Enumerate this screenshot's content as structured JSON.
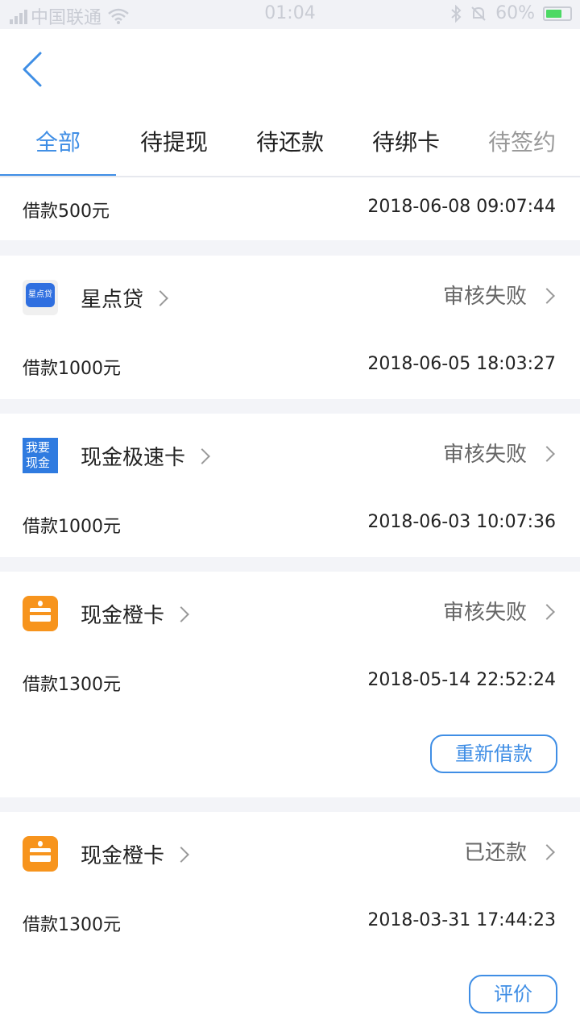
{
  "status_bar": {
    "carrier": "中国联通",
    "time": "01:04",
    "battery": "60%"
  },
  "tabs": [
    {
      "label": "全部",
      "active": true
    },
    {
      "label": "待提现",
      "active": false
    },
    {
      "label": "待还款",
      "active": false
    },
    {
      "label": "待绑卡",
      "active": false
    },
    {
      "label": "待签约",
      "active": false
    }
  ],
  "top_row": {
    "amount": "借款500元",
    "time": "2018-06-08 09:07:44"
  },
  "records": [
    {
      "lender": "星点贷",
      "logo_text": "星点贷",
      "status": "审核失败",
      "amount": "借款1000元",
      "time": "2018-06-05 18:03:27"
    },
    {
      "lender": "现金极速卡",
      "logo_text": "我要现金",
      "status": "审核失败",
      "amount": "借款1000元",
      "time": "2018-06-03 10:07:36"
    },
    {
      "lender": "现金橙卡",
      "status": "审核失败",
      "amount": "借款1300元",
      "time": "2018-05-14 22:52:24",
      "action": "重新借款"
    },
    {
      "lender": "现金橙卡",
      "status": "已还款",
      "amount": "借款1300元",
      "time": "2018-03-31 17:44:23",
      "action": "评价"
    }
  ],
  "colors": {
    "accent": "#3f8ee5",
    "page_bg": "#f3f4f8",
    "orange_logo": "#f7941d",
    "blue_logo": "#2f7be0"
  },
  "icons": {
    "back": "chevron-left-icon",
    "row_arrow": "chevron-right-icon"
  }
}
